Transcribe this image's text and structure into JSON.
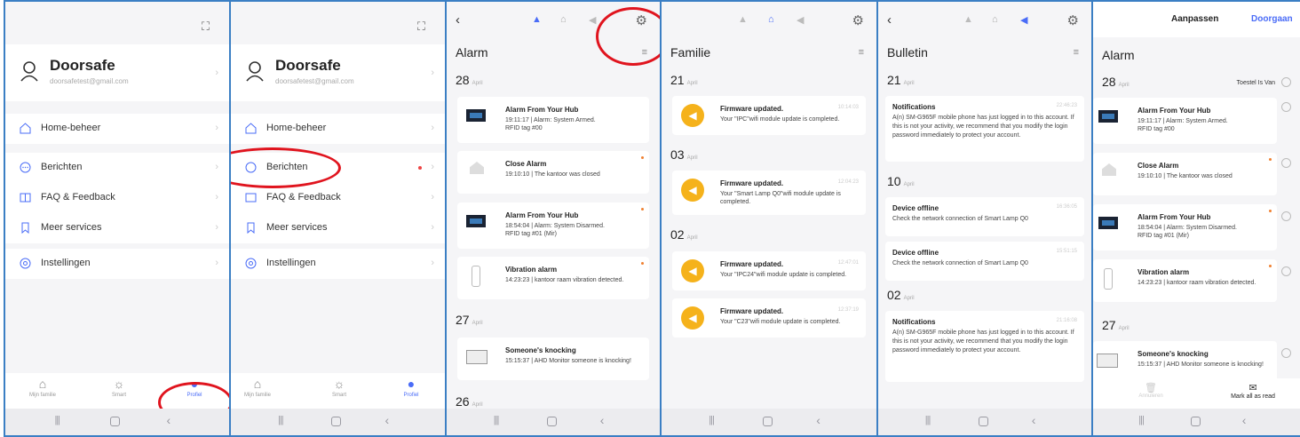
{
  "profile": {
    "name": "Doorsafe",
    "email": "doorsafetest@gmail.com"
  },
  "menu": {
    "home": "Home-beheer",
    "messages": "Berichten",
    "faq": "FAQ & Feedback",
    "services": "Meer services",
    "settings": "Instellingen"
  },
  "tabs": {
    "family": "Mijn familie",
    "smart": "Smart",
    "profile": "Profiel"
  },
  "alarm": {
    "title": "Alarm",
    "groups": [
      {
        "day": "28",
        "month": "April",
        "items": [
          {
            "title": "Alarm From Your Hub",
            "body1": "19:11:17 | Alarm: System Armed.",
            "body2": "RFID tag #00"
          },
          {
            "title": "Close Alarm",
            "body1": "19:10:10 | The kantoor was closed"
          },
          {
            "title": "Alarm From Your Hub",
            "body1": "18:54:04 | Alarm: System Disarmed.",
            "body2": "RFID tag #01 (Mir)"
          },
          {
            "title": "Vibration alarm",
            "body1": "14:23:23 | kantoor raam vibration detected."
          }
        ]
      },
      {
        "day": "27",
        "month": "April",
        "items": [
          {
            "title": "Someone's knocking",
            "body1": "15:15:37 | AHD Monitor someone is knocking!"
          }
        ]
      },
      {
        "day": "26",
        "month": "April"
      }
    ]
  },
  "familie": {
    "title": "Familie",
    "groups": [
      {
        "day": "21",
        "month": "April",
        "items": [
          {
            "title": "Firmware updated.",
            "time": "10:14:03",
            "body": "Your \"IPC\"wifi module update is completed."
          }
        ]
      },
      {
        "day": "03",
        "month": "April",
        "items": [
          {
            "title": "Firmware updated.",
            "time": "12:04:23",
            "body": "Your \"Smart Lamp Q0\"wifi module update is completed."
          }
        ]
      },
      {
        "day": "02",
        "month": "April",
        "items": [
          {
            "title": "Firmware updated.",
            "time": "12:47:01",
            "body": "Your \"IPC24\"wifi module update is completed."
          },
          {
            "title": "Firmware updated.",
            "time": "12:37:19",
            "body": "Your \"C23\"wifi module update is completed."
          }
        ]
      }
    ]
  },
  "bulletin": {
    "title": "Bulletin",
    "groups": [
      {
        "day": "21",
        "month": "April",
        "items": [
          {
            "title": "Notifications",
            "time": "22:46:23",
            "body": "A(n) SM-G965F mobile phone has just logged in to this account. If this is not your activity, we recommend that you modify the login password immediately to protect your account."
          }
        ]
      },
      {
        "day": "10",
        "month": "April",
        "items": [
          {
            "title": "Device offline",
            "time": "16:36:05",
            "body": "Check the network connection of Smart Lamp Q0"
          },
          {
            "title": "Device offline",
            "time": "15:51:15",
            "body": "Check the network connection of Smart Lamp Q0"
          }
        ]
      },
      {
        "day": "02",
        "month": "April",
        "items": [
          {
            "title": "Notifications",
            "time": "21:16:08",
            "body": "A(n) SM-G965F mobile phone has just logged in to this account. If this is not your activity, we recommend that you modify the login password immediately to protect your account."
          }
        ]
      }
    ]
  },
  "edit": {
    "header_title": "Aanpassen",
    "done": "Doorgaan",
    "section_title": "Alarm",
    "device_off": "Toestel Is Van",
    "cancel": "Annuleren",
    "mark_all": "Mark all as read"
  }
}
